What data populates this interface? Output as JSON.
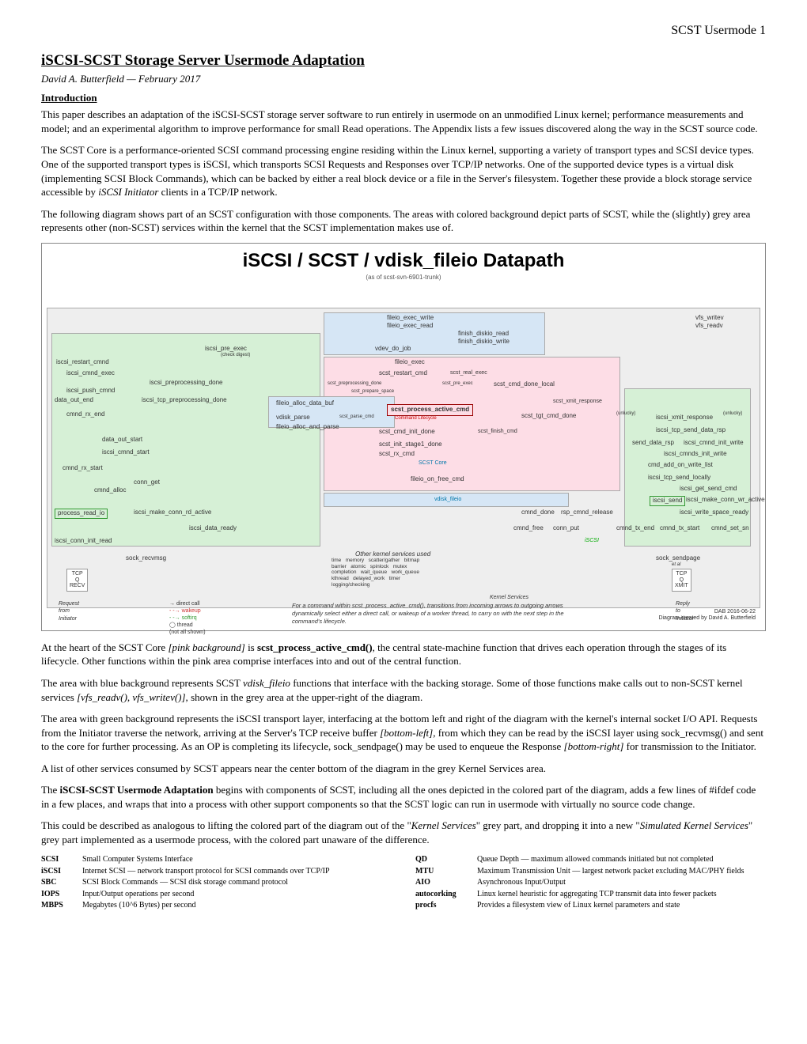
{
  "header_right": "SCST Usermode  1",
  "title": "iSCSI-SCST Storage Server Usermode Adaptation",
  "byline": "David A. Butterfield — February 2017",
  "intro_heading": "Introduction",
  "p1": "This paper describes an adaptation of the iSCSI-SCST storage server software to run entirely in usermode on an unmodified Linux kernel; performance measurements and model; and an experimental algorithm to improve performance for small Read operations. The Appendix lists a few issues discovered along the way in the SCST source code.",
  "p2_a": "The SCST Core is a performance-oriented SCSI command processing engine residing within the Linux kernel, supporting a variety of transport types and SCSI device types. One of the supported transport types is iSCSI, which transports SCSI Requests and Responses over TCP/IP networks. One of the supported device types is a virtual disk (implementing SCSI Block Commands), which can be backed by either a real block device or a file in the Server's filesystem. Together these provide a block storage service accessible by ",
  "p2_b": "iSCSI Initiator",
  "p2_c": " clients in a TCP/IP network.",
  "p3": "The following diagram shows part of an SCST configuration with those components. The areas with colored background depict parts of SCST, while the (slightly) grey area represents other (non-SCST) services within the kernel that the SCST implementation makes use of.",
  "diagram": {
    "title": "iSCSI / SCST / vdisk_fileio Datapath",
    "sub": "(as of scst-svn-6901-trunk)",
    "labels": {
      "fileio_exec_write": "fileio_exec_write",
      "fileio_exec_read": "fileio_exec_read",
      "vfs_writev": "vfs_writev",
      "vfs_readv": "vfs_readv",
      "finish_diskio_read": "finish_diskio_read",
      "finish_diskio_write": "finish_diskio_write",
      "vdev_do_job": "vdev_do_job",
      "iscsi_pre_exec": "iscsi_pre_exec",
      "check_digest": "(check digest)",
      "fileio_exec": "fileio_exec",
      "iscsi_restart_cmnd": "iscsi_restart_cmnd",
      "iscsi_cmnd_exec": "iscsi_cmnd_exec",
      "scst_restart_cmd": "scst_restart_cmd",
      "scst_real_exec": "scst_real_exec",
      "iscsi_preprocessing_done": "iscsi_preprocessing_done",
      "scst_preprocessing_done": "scst_preprocessing_done",
      "iscsi_push_cmnd": "iscsi_push_cmnd",
      "scst_prepare_space": "scst_prepare_space",
      "scst_pre_exec": "scst_pre_exec",
      "scst_cmd_done_local": "scst_cmd_done_local",
      "iscsi_tcp_preprocessing_done": "iscsi_tcp_preprocessing_done",
      "data_out_end": "data_out_end",
      "fileio_alloc_data_buf": "fileio_alloc_data_buf",
      "scst_xmit_response": "scst_xmit_response",
      "scst_process_active_cmd": "scst_process_active_cmd",
      "cmnd_rx_end": "cmnd_rx_end",
      "vdisk_parse": "vdisk_parse",
      "scst_parse_cmd": "scst_parse_cmd",
      "command_lifecycle": "Command Lifecycle",
      "scst_tgt_cmd_done": "scst_tgt_cmd_done",
      "unlucky": "(unlucky)",
      "fileio_alloc_and_parse": "fileio_alloc_and_parse",
      "iscsi_xmit_response": "iscsi_xmit_response",
      "scst_cmd_init_done": "scst_cmd_init_done",
      "scst_finish_cmd": "scst_finish_cmd",
      "iscsi_tcp_send_data_rsp": "iscsi_tcp_send_data_rsp",
      "data_out_start": "data_out_start",
      "scst_init_stage1_done": "scst_init_stage1_done",
      "send_data_rsp": "send_data_rsp",
      "iscsi_cmnd_init_write": "iscsi_cmnd_init_write",
      "scst_rx_cmd": "scst_rx_cmd",
      "iscsi_cmnd_start": "iscsi_cmnd_start",
      "iscsi_cmnds_init_write": "iscsi_cmnds_init_write",
      "scst_core": "SCST Core",
      "cmd_add_on_write_list": "cmd_add_on_write_list",
      "wakeup_writer": "wakeup",
      "cmnd_rx_start": "cmnd_rx_start",
      "fileio_on_free_cmd": "fileio_on_free_cmd",
      "iscsi_tcp_send_locally": "iscsi_tcp_send_locally",
      "conn_get": "conn_get",
      "cmnd_alloc": "cmnd_alloc",
      "iscsi_get_send_cmd": "iscsi_get_send_cmd",
      "vdisk_fileio": "vdisk_fileio",
      "iscsi_send": "iscsi_send",
      "iscsi_make_conn_wr_active": "iscsi_make_conn_wr_active",
      "process_read_io": "process_read_io",
      "iscsi_make_conn_rd_active": "iscsi_make_conn_rd_active",
      "cmnd_done": "cmnd_done",
      "rsp_cmnd_release": "rsp_cmnd_release",
      "iscsi_write_space_ready": "iscsi_write_space_ready",
      "iscsi_data_ready": "iscsi_data_ready",
      "iscsi_conn_init_read": "iscsi_conn_init_read",
      "cmnd_free": "cmnd_free",
      "conn_put": "conn_put",
      "cmnd_tx_end": "cmnd_tx_end",
      "cmnd_tx_start": "cmnd_tx_start",
      "cmnd_set_sn": "cmnd_set_sn",
      "iscsi_label": "iSCSI",
      "sock_recvmsg": "sock_recvmsg",
      "other_kernel": "Other kernel services used",
      "kernel_list": "time   memory   scatter/gather   bitmap\nbarrier   atomic   spinlock   mutex\ncompletion   wait_queue   work_queue\nkthread   delayed_work   timer\nlogging/checking",
      "sock_sendpage": "sock_sendpage",
      "et_al": "et al",
      "tcp_q_recv": "TCP\nQ\nRECV",
      "tcp_q_xmit": "TCP\nQ\nXMIT",
      "kernel_services": "Kernel Services",
      "request_from": "Request\nfrom\nInitiator",
      "reply_to": "Reply\nto\nInitiator",
      "legend1": "direct call",
      "legend2": "wakeup",
      "legend3": "softirq",
      "legend4": "thread\n(not all shown)",
      "note": "For a command within scst_process_active_cmd(), transitions from incoming arrows to outgoing arrows dynamically select either a direct call, or wakeup of a worker thread, to carry on with the next step in the command's lifecycle.",
      "credit1": "DAB 2016-06-22",
      "credit2": "Diagram created by David A. Butterfield"
    }
  },
  "p4_a": "At the heart of the SCST Core ",
  "p4_b": "[pink background]",
  "p4_c": " is ",
  "p4_d": "scst_process_active_cmd()",
  "p4_e": ", the central state-machine function that drives each operation through the stages of its lifecycle. Other functions within the pink area comprise interfaces into and out of the central function.",
  "p5_a": "The area with blue background represents SCST ",
  "p5_b": "vdisk_fileio",
  "p5_c": " functions that interface with the backing storage. Some of those functions make calls out to non-SCST kernel services ",
  "p5_d": "[vfs_readv(), vfs_writev()],",
  "p5_e": " shown in the grey area at the upper-right of the diagram.",
  "p6_a": "The area with green background represents the iSCSI transport layer, interfacing at the bottom left and right of the diagram with the kernel's internal socket I/O API. Requests from the Initiator traverse the network, arriving at the Server's TCP receive buffer ",
  "p6_b": "[bottom-left],",
  "p6_c": " from which they can be read by the iSCSI layer using sock_recvmsg() and sent to the core for further processing. As an OP is completing its lifecycle, sock_sendpage() may be used to enqueue the Response ",
  "p6_d": "[bottom-right]",
  "p6_e": " for transmission to the Initiator.",
  "p7": "A list of other services consumed by SCST appears near the center bottom of the diagram in the grey Kernel Services area.",
  "p8_a": "The ",
  "p8_b": "iSCSI-SCST Usermode Adaptation",
  "p8_c": " begins with components of SCST, including all the ones depicted in the colored part of the diagram, adds a few lines of #ifdef code in a few places, and wraps that into a process with other support components so that the SCST logic can run in usermode with virtually no source code change.",
  "p9_a": "This could be described as analogous to lifting the colored part of the diagram out of the \"",
  "p9_b": "Kernel Services",
  "p9_c": "\" grey part, and dropping it into a new \"",
  "p9_d": "Simulated Kernel Services",
  "p9_e": "\" grey part implemented as a usermode process, with the colored part unaware of the difference.",
  "glossary": {
    "left": [
      {
        "term": "SCSI",
        "def": "Small Computer Systems Interface"
      },
      {
        "term": "iSCSI",
        "def": "Internet SCSI — network transport protocol for SCSI commands over TCP/IP"
      },
      {
        "term": "SBC",
        "def": "SCSI Block Commands — SCSI disk storage command protocol"
      },
      {
        "term": "IOPS",
        "def": "Input/Output operations per second"
      },
      {
        "term": "MBPS",
        "def": "Megabytes (10^6 Bytes) per second"
      }
    ],
    "right": [
      {
        "term": "QD",
        "def": "Queue Depth — maximum allowed commands initiated but not completed"
      },
      {
        "term": "MTU",
        "def": "Maximum Transmission Unit — largest network packet excluding MAC/PHY fields"
      },
      {
        "term": "AIO",
        "def": "Asynchronous Input/Output"
      },
      {
        "term": "autocorking",
        "def": "Linux kernel heuristic for aggregating TCP transmit data into fewer packets"
      },
      {
        "term": "procfs",
        "def": "Provides a filesystem view of Linux kernel parameters and state"
      }
    ]
  }
}
